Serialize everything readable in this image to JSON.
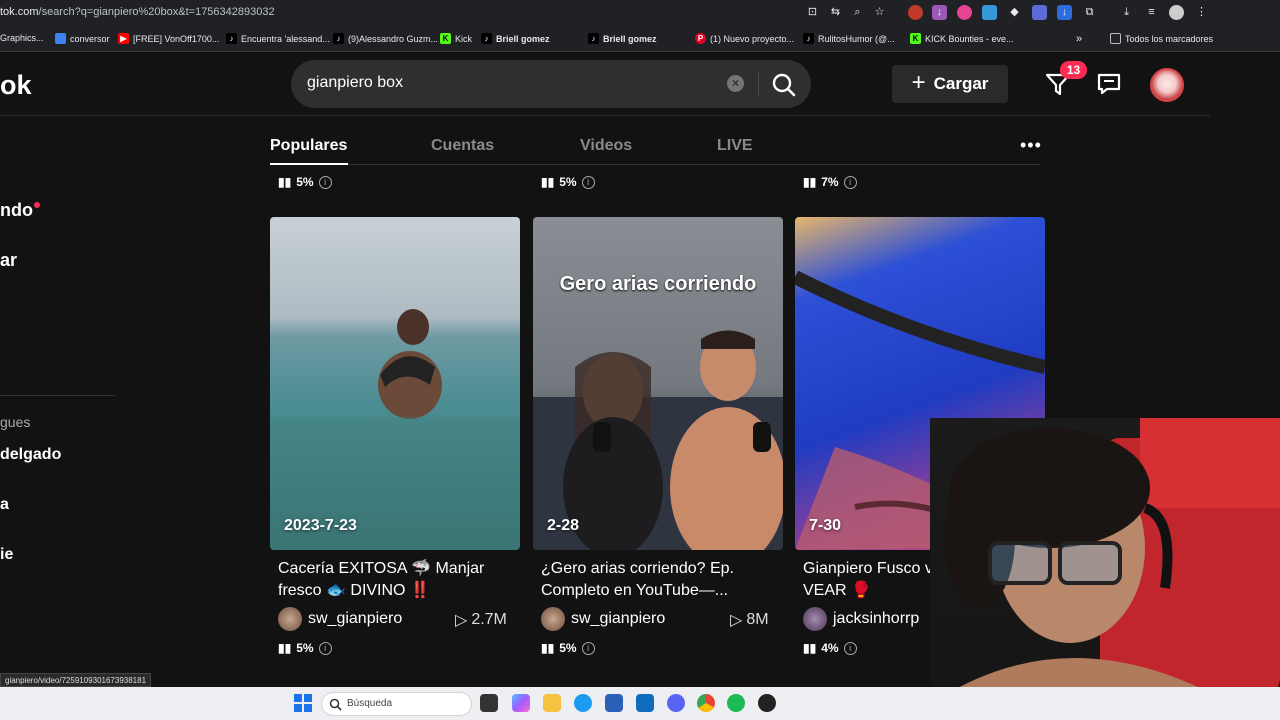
{
  "browser": {
    "url_host": "tok.com",
    "url_path": "/search?q=gianpiero%20box&t=1756342893032",
    "bookmarks": [
      {
        "label": "Graphics...",
        "icon": "none"
      },
      {
        "label": "conversor",
        "icon": "generic-bookmark-icon"
      },
      {
        "label": "[FREE] VonOff1700...",
        "icon": "youtube-icon"
      },
      {
        "label": "Encuentra 'alessand...",
        "icon": "tiktok-icon"
      },
      {
        "label": "(9)Alessandro Guzm...",
        "icon": "tiktok-icon"
      },
      {
        "label": "Kick",
        "icon": "kick-icon"
      },
      {
        "label": "Briell gomez",
        "icon": "tiktok-icon"
      },
      {
        "label": "Briell gomez",
        "icon": "tiktok-icon"
      },
      {
        "label": "(1) Nuevo proyecto...",
        "icon": "pinterest-icon"
      },
      {
        "label": "RulitosHumor (@...",
        "icon": "tiktok-icon"
      },
      {
        "label": "KICK Bounties - eve...",
        "icon": "kick-icon"
      }
    ],
    "all_bookmarks_label": "Todos los marcadores",
    "status_url": "gianpiero/video/7259109301673938181"
  },
  "header": {
    "logo_fragment": "ok",
    "search_value": "gianpiero box",
    "upload_label": "Cargar",
    "notification_count": "13"
  },
  "sidebar": {
    "items": [
      {
        "label": "ndo"
      },
      {
        "label": "ar"
      }
    ],
    "following_title": "gues",
    "users": [
      {
        "label": "delgado"
      },
      {
        "label": "a"
      },
      {
        "label": "ie"
      }
    ]
  },
  "tabs": [
    {
      "label": "Populares",
      "active": true
    },
    {
      "label": "Cuentas",
      "active": false
    },
    {
      "label": "Videos",
      "active": false
    },
    {
      "label": "LIVE",
      "active": false
    }
  ],
  "top_stats": [
    "5%",
    "5%",
    "7%"
  ],
  "cards": [
    {
      "date": "2023-7-23",
      "title": "Cacería EXITOSA 🦈 Manjar fresco 🐟 DIVINO ‼️",
      "author": "sw_gianpiero",
      "views": "2.7M",
      "stat": "5%"
    },
    {
      "date": "2-28",
      "overlay_text": "Gero arias corriendo",
      "title": "¿Gero arias corriendo? Ep. Completo en YouTube—...",
      "author": "sw_gianpiero",
      "views": "8M",
      "stat": "5%"
    },
    {
      "date": "7-30",
      "title": "Gianpiero Fusco vs VEAR 🥊",
      "author": "jacksinhorrp",
      "views": "",
      "stat": "4%"
    }
  ],
  "taskbar": {
    "search_label": "Búsqueda"
  },
  "colors": {
    "accent": "#fe2c55",
    "background": "#121212",
    "search_bg": "#2f2f2f"
  }
}
